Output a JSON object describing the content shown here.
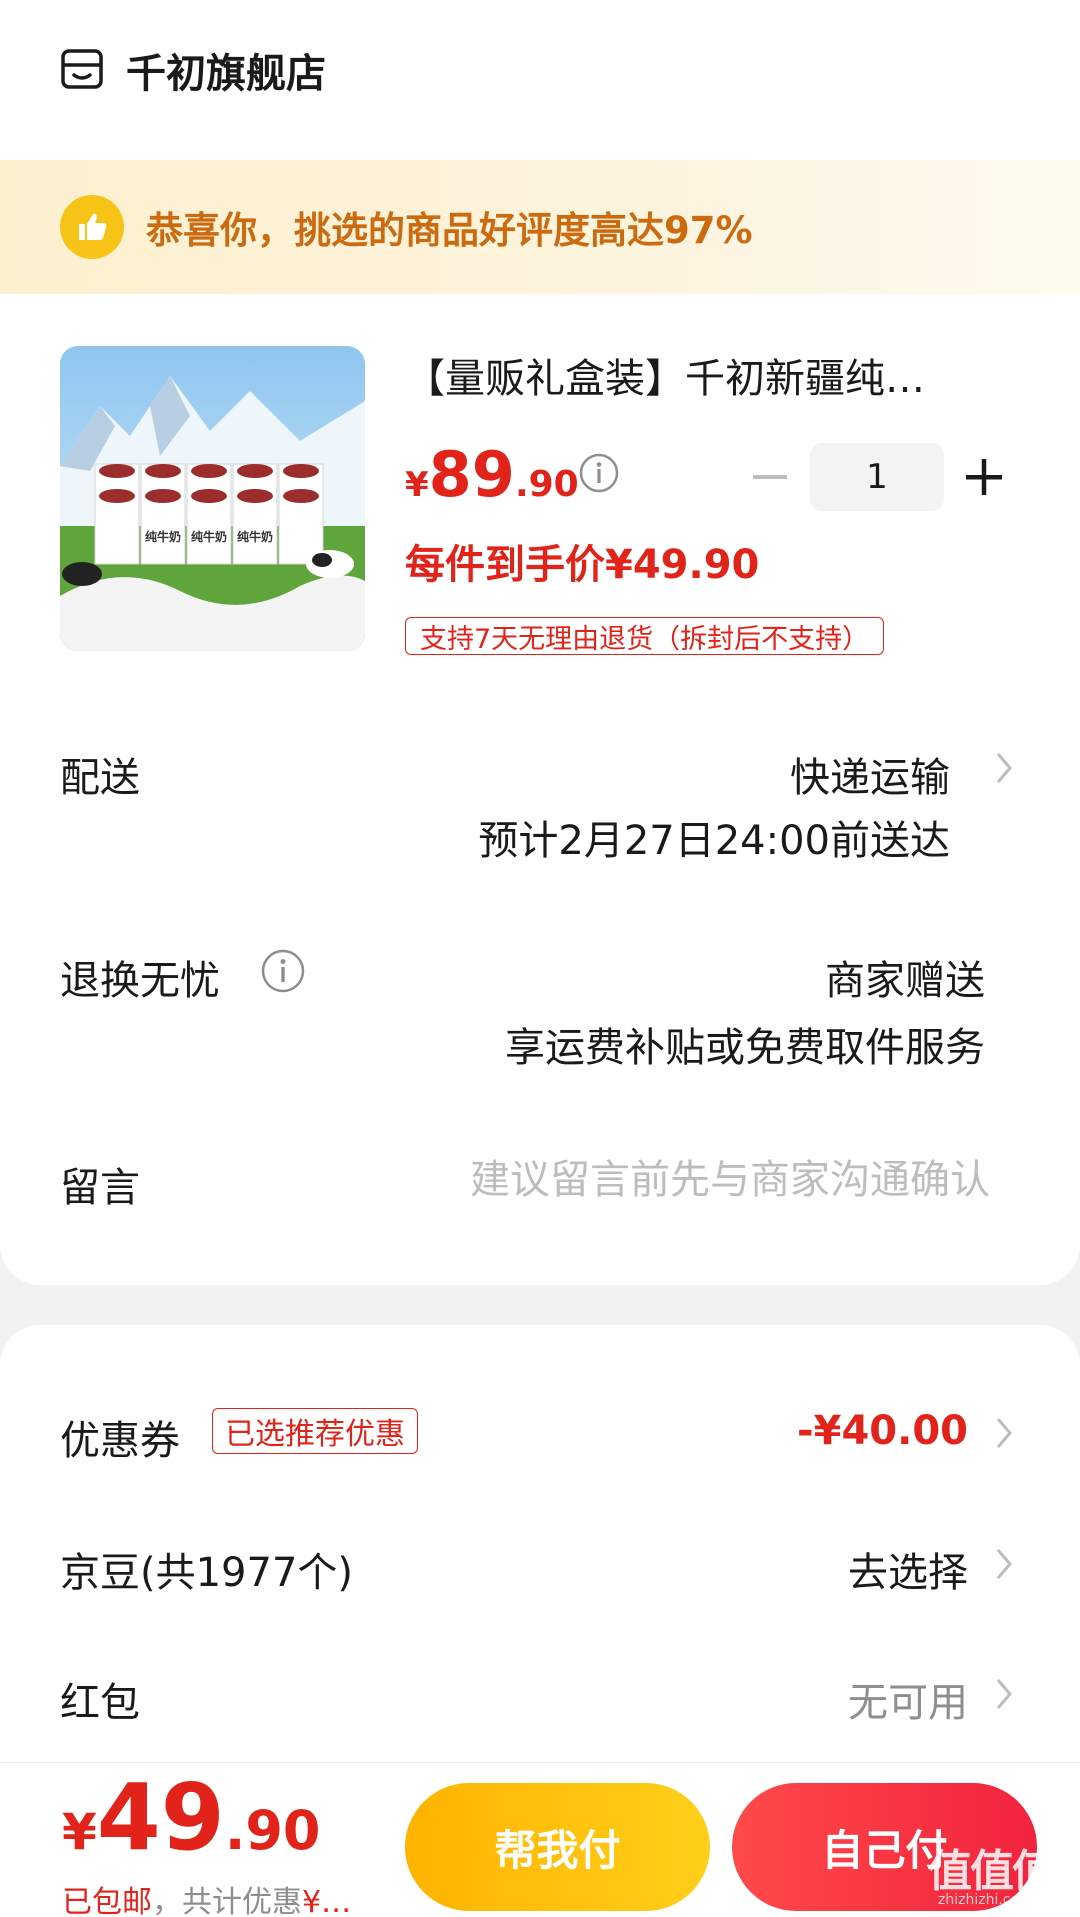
{
  "store": {
    "name": "千初旗舰店",
    "icon": "store-icon"
  },
  "banner": {
    "text": "恭喜你，挑选的商品好评度高达97%",
    "icon": "thumbs-up-icon",
    "accent": "#cc6a10",
    "icon_color": "#f7c317"
  },
  "product": {
    "title": "【量贩礼盒装】千初新疆纯…",
    "price_symbol": "¥",
    "price_int": "89",
    "price_dec": ".90",
    "unit_price": "每件到手价¥49.90",
    "quantity": "1",
    "minus": "−",
    "plus": "+",
    "return_tag": "支持7天无理由退货（拆封后不支持）",
    "image_text": [
      "纯牛奶",
      "纯牛奶",
      "纯牛奶"
    ]
  },
  "delivery": {
    "label": "配送",
    "method": "快递运输",
    "eta": "预计2月27日24:00前送达"
  },
  "return_worry": {
    "label": "退换无忧",
    "value": "商家赠送",
    "desc": "享运费补贴或免费取件服务"
  },
  "message": {
    "label": "留言",
    "placeholder": "建议留言前先与商家沟通确认"
  },
  "coupon": {
    "label": "优惠券",
    "badge": "已选推荐优惠",
    "value": "-¥40.00"
  },
  "jingdou": {
    "label": "京豆(共1977个)",
    "value": "去选择"
  },
  "hongbao": {
    "label": "红包",
    "value": "无可用"
  },
  "footer": {
    "total_symbol": "¥",
    "total_int": "49",
    "total_dec": ".90",
    "shipping": "已包邮",
    "saved": "，共计优惠",
    "saved_value": "¥…",
    "help_pay": "帮我付",
    "self_pay": "自己付",
    "watermark": "值值值",
    "watermark_sub": "zhizhizhi.com"
  },
  "colors": {
    "red": "#e2231a",
    "yellow": "#ffc107"
  }
}
